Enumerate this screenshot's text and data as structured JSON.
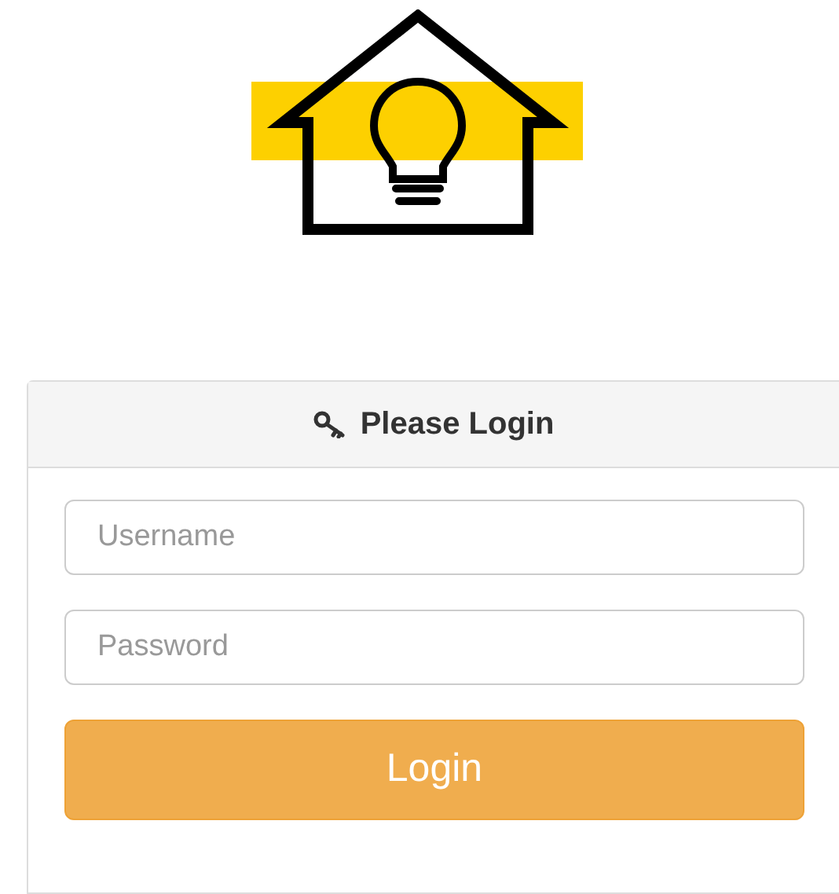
{
  "panel": {
    "title": "Please Login"
  },
  "fields": [
    {
      "placeholder": "Username"
    },
    {
      "placeholder": "Password"
    }
  ],
  "button": {
    "label": "Login"
  }
}
